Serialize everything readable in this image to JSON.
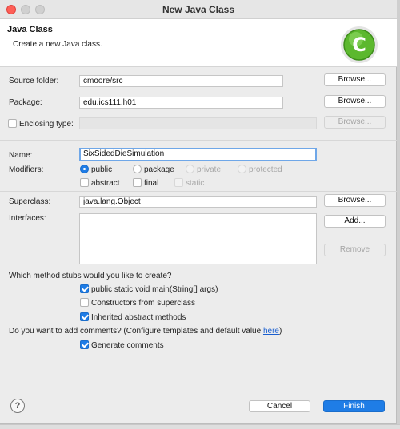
{
  "window": {
    "title": "New Java Class"
  },
  "banner": {
    "title": "Java Class",
    "subtitle": "Create a new Java class.",
    "logo_icon": "java-class-c-logo-icon"
  },
  "source_folder": {
    "label": "Source folder:",
    "value": "cmoore/src",
    "button": "Browse..."
  },
  "package": {
    "label": "Package:",
    "value": "edu.ics111.h01",
    "button": "Browse..."
  },
  "enclosing": {
    "label": "Enclosing type:",
    "value": "",
    "button": "Browse..."
  },
  "name": {
    "label": "Name:",
    "value": "SixSidedDieSimulation"
  },
  "modifiers": {
    "label": "Modifiers:",
    "options": [
      "public",
      "package",
      "private",
      "protected"
    ],
    "selected": "public",
    "checks": [
      "abstract",
      "final",
      "static"
    ]
  },
  "superclass": {
    "label": "Superclass:",
    "value": "java.lang.Object",
    "button": "Browse..."
  },
  "interfaces": {
    "label": "Interfaces:",
    "add_button": "Add...",
    "remove_button": "Remove"
  },
  "stubs": {
    "question": "Which method stubs would you like to create?",
    "items": [
      {
        "label": "public static void main(String[] args)",
        "checked": true
      },
      {
        "label": "Constructors from superclass",
        "checked": false
      },
      {
        "label": "Inherited abstract methods",
        "checked": true
      }
    ]
  },
  "comments": {
    "question_prefix": "Do you want to add comments? (Configure templates and default value ",
    "link": "here",
    "question_suffix": ")",
    "item": {
      "label": "Generate comments",
      "checked": true
    }
  },
  "footer": {
    "help_label": "?",
    "cancel": "Cancel",
    "finish": "Finish"
  },
  "colors": {
    "accent": "#1f7de6",
    "focus": "#6fa7e8",
    "close": "#fe5f57"
  }
}
